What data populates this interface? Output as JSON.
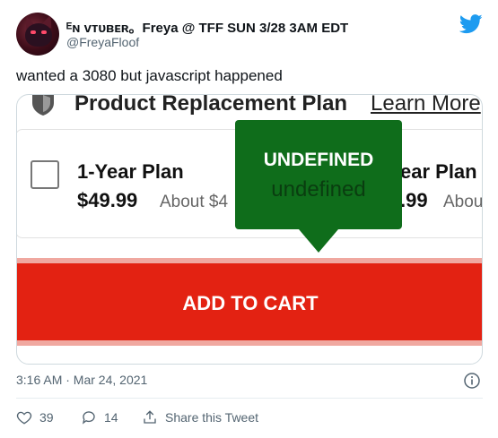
{
  "user": {
    "display_name": "ᴱɴ ᴠᴛᴜʙᴇʀ。Freya @ TFF SUN 3/28 3AM EDT",
    "handle": "@FreyaFloof"
  },
  "tweet_text": "wanted a 3080 but javascript happened",
  "media": {
    "header": {
      "title": "Product Replacement Plan",
      "learn_more": "Learn More"
    },
    "plan": {
      "name": "1-Year Plan",
      "price": "$49.99",
      "about": "About $4",
      "name_partial": "ear Plan",
      "price_partial": ".99",
      "about_partial": "Abou"
    },
    "tooltip": {
      "title": "UNDEFINED",
      "subtitle": "undefined"
    },
    "cart_button": "ADD TO CART"
  },
  "timestamp": "3:16 AM · Mar 24, 2021",
  "actions": {
    "likes": "39",
    "replies": "14",
    "share": "Share this Tweet"
  },
  "colors": {
    "tooltip_green": "#0f6d1b",
    "cart_red": "#e32212",
    "twitter_blue": "#1d9bf0"
  }
}
